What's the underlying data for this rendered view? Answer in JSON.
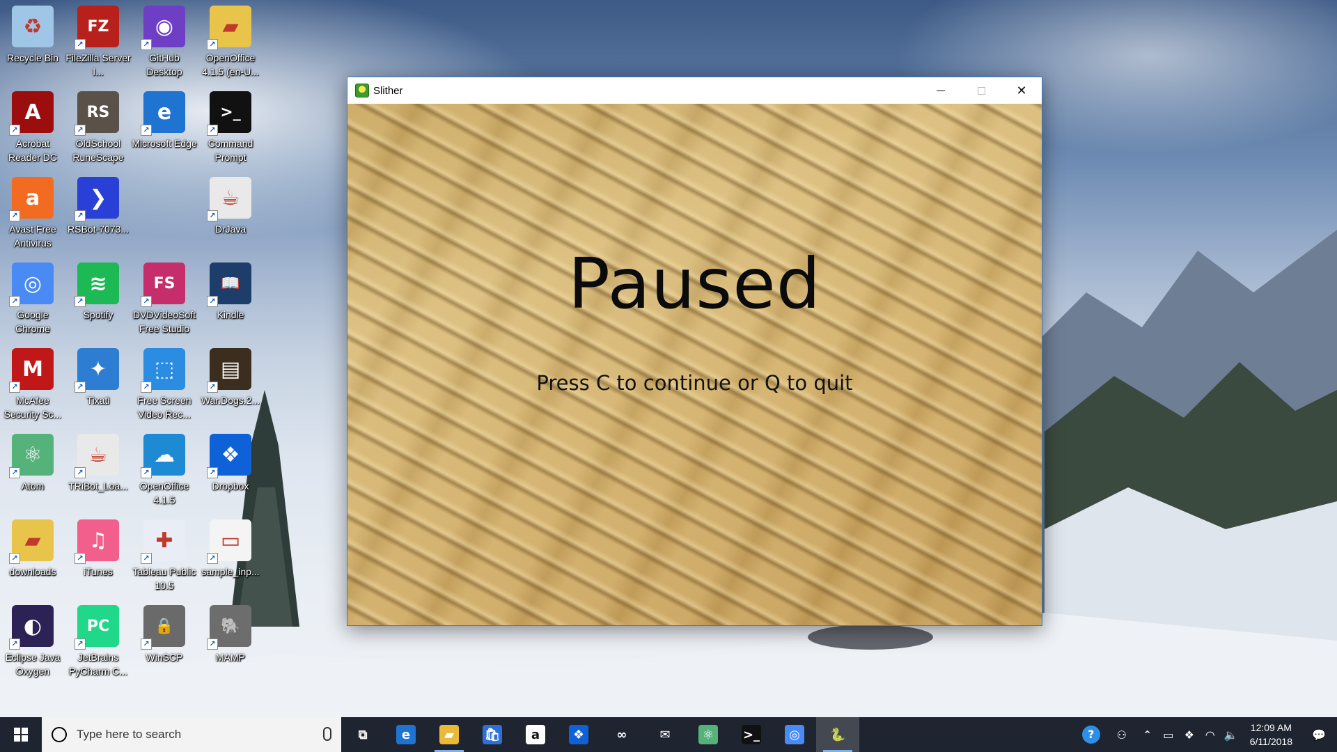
{
  "desktop": {
    "icons": [
      {
        "label": "Recycle Bin",
        "icon": "recycle-bin-icon",
        "color": "#9fc6e6",
        "glyph": "♻"
      },
      {
        "label": "FileZilla Server I...",
        "icon": "filezilla-icon",
        "color": "#b8201b",
        "glyph": "FZ"
      },
      {
        "label": "GitHub Desktop",
        "icon": "github-icon",
        "color": "#6e3fc5",
        "glyph": "◉"
      },
      {
        "label": "OpenOffice 4.1.5 (en-U...",
        "icon": "folder-icon",
        "color": "#e9c44a",
        "glyph": "▰"
      },
      {
        "label": "Acrobat Reader DC",
        "icon": "acrobat-icon",
        "color": "#9c0d0d",
        "glyph": "A"
      },
      {
        "label": "OldSchool RuneScape",
        "icon": "runescape-icon",
        "color": "#5a5248",
        "glyph": "RS"
      },
      {
        "label": "Microsoft Edge",
        "icon": "edge-icon",
        "color": "#1f73d1",
        "glyph": "e"
      },
      {
        "label": "Command Prompt",
        "icon": "command-prompt-icon",
        "color": "#111111",
        "glyph": ">_"
      },
      {
        "label": "Avast Free Antivirus",
        "icon": "avast-icon",
        "color": "#f26b21",
        "glyph": "a"
      },
      {
        "label": "RSBot-7073...",
        "icon": "rsbot-icon",
        "color": "#2a3fd6",
        "glyph": "❯"
      },
      {
        "label": "DrJava",
        "icon": "java-icon",
        "color": "#e9e9e9",
        "glyph": "☕"
      },
      {
        "label": "Google Chrome",
        "icon": "chrome-icon",
        "color": "#4a8af4",
        "glyph": "◎"
      },
      {
        "label": "Spotify",
        "icon": "spotify-icon",
        "color": "#1db954",
        "glyph": "≋"
      },
      {
        "label": "DVDVideoSoft Free Studio",
        "icon": "dvdvideosoft-icon",
        "color": "#c62e6b",
        "glyph": "FS"
      },
      {
        "label": "Kindle",
        "icon": "kindle-icon",
        "color": "#1d3e6b",
        "glyph": "📖"
      },
      {
        "label": "McAfee Security Sc...",
        "icon": "mcafee-icon",
        "color": "#c01818",
        "glyph": "M"
      },
      {
        "label": "Tixati",
        "icon": "tixati-icon",
        "color": "#2d7dd2",
        "glyph": "✦"
      },
      {
        "label": "Free Screen Video Rec...",
        "icon": "screen-recorder-icon",
        "color": "#2b8de2",
        "glyph": "⬚"
      },
      {
        "label": "War.Dogs.2...",
        "icon": "video-file-icon",
        "color": "#3b2e1e",
        "glyph": "▤"
      },
      {
        "label": "Atom",
        "icon": "atom-icon",
        "color": "#55b27a",
        "glyph": "⚛"
      },
      {
        "label": "TRiBot_Loa...",
        "icon": "java-icon",
        "color": "#e9e9e9",
        "glyph": "☕"
      },
      {
        "label": "OpenOffice 4.1.5",
        "icon": "openoffice-icon",
        "color": "#1f8ad4",
        "glyph": "☁"
      },
      {
        "label": "Dropbox",
        "icon": "dropbox-icon",
        "color": "#0f61d8",
        "glyph": "❖"
      },
      {
        "label": "downloads",
        "icon": "folder-icon",
        "color": "#e9c44a",
        "glyph": "▰"
      },
      {
        "label": "iTunes",
        "icon": "itunes-icon",
        "color": "#f25f8d",
        "glyph": "♫"
      },
      {
        "label": "Tableau Public 10.5",
        "icon": "tableau-icon",
        "color": "#e9eef6",
        "glyph": "✚"
      },
      {
        "label": "sample_inp...",
        "icon": "text-file-icon",
        "color": "#f4f4f4",
        "glyph": "▭"
      },
      {
        "label": "Eclipse Java Oxygen",
        "icon": "eclipse-icon",
        "color": "#2c2255",
        "glyph": "◐"
      },
      {
        "label": "JetBrains PyCharm C...",
        "icon": "pycharm-icon",
        "color": "#21d789",
        "glyph": "PC"
      },
      {
        "label": "WinSCP",
        "icon": "winscp-icon",
        "color": "#6a6a6a",
        "glyph": "🔒"
      },
      {
        "label": "MAMP",
        "icon": "mamp-icon",
        "color": "#6d6d6d",
        "glyph": "🐘"
      }
    ]
  },
  "window": {
    "title": "Slither",
    "minimize": "minimize",
    "maximize": "maximize",
    "close": "✕"
  },
  "game": {
    "heading": "Paused",
    "hint": "Press C to continue or Q to quit"
  },
  "taskbar": {
    "search_placeholder": "Type here to search",
    "apps": [
      {
        "icon": "task-view-icon",
        "glyph": "⧉",
        "color": "transparent",
        "running": false
      },
      {
        "icon": "edge-icon",
        "glyph": "e",
        "color": "#1f73d1",
        "running": false
      },
      {
        "icon": "file-explorer-icon",
        "glyph": "▰",
        "color": "#e9b93a",
        "running": true
      },
      {
        "icon": "store-icon",
        "glyph": "🛍",
        "color": "#2f6fd6",
        "running": false
      },
      {
        "icon": "amazon-icon",
        "glyph": "a",
        "color": "#ffffff",
        "running": false
      },
      {
        "icon": "dropbox-icon",
        "glyph": "❖",
        "color": "#0f61d8",
        "running": false
      },
      {
        "icon": "arduino-icon",
        "glyph": "∞",
        "color": "transparent",
        "running": false
      },
      {
        "icon": "mail-icon",
        "glyph": "✉",
        "color": "transparent",
        "running": false
      },
      {
        "icon": "atom-icon",
        "glyph": "⚛",
        "color": "#55b27a",
        "running": false
      },
      {
        "icon": "command-prompt-icon",
        "glyph": ">_",
        "color": "#111111",
        "running": false
      },
      {
        "icon": "chrome-icon",
        "glyph": "◎",
        "color": "#4a8af4",
        "running": false
      },
      {
        "icon": "python-icon",
        "glyph": "🐍",
        "color": "transparent",
        "running": true,
        "active": true
      }
    ],
    "tray": {
      "time": "12:09 AM",
      "date": "6/11/2018"
    }
  }
}
